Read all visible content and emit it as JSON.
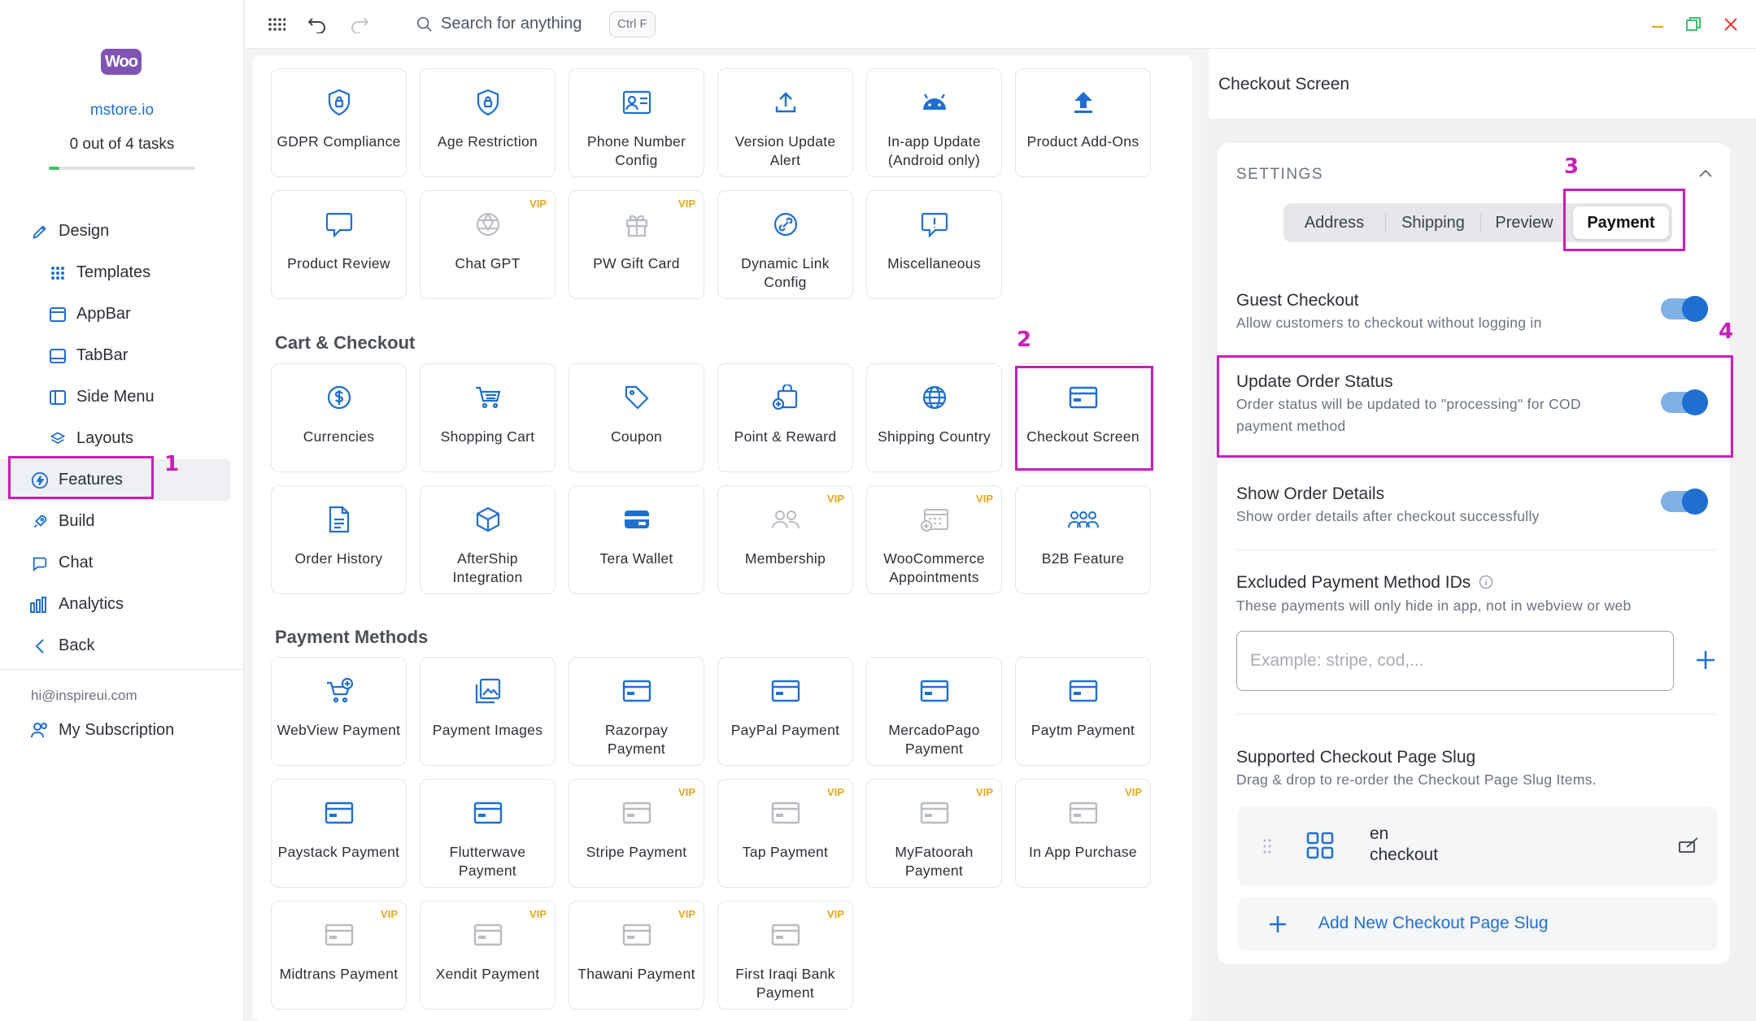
{
  "sidebar": {
    "logo_text": "Woo",
    "store_name": "mstore.io",
    "tasks_text": "0 out of 4 tasks",
    "progress": 0.07,
    "items": [
      {
        "label": "Design"
      },
      {
        "label": "Templates"
      },
      {
        "label": "AppBar"
      },
      {
        "label": "TabBar"
      },
      {
        "label": "Side Menu"
      },
      {
        "label": "Layouts"
      },
      {
        "label": "Features"
      },
      {
        "label": "Build"
      },
      {
        "label": "Chat"
      },
      {
        "label": "Analytics"
      },
      {
        "label": "Back"
      }
    ],
    "email": "hi@inspireui.com",
    "subscription": "My Subscription"
  },
  "topbar": {
    "search_placeholder": "Search for anything",
    "shortcut": "Ctrl F"
  },
  "features": {
    "row1": [
      "GDPR Compliance",
      "Age Restriction",
      "Phone Number Config",
      "Version Update Alert",
      "In-app Update (Android only)",
      "Product Add-Ons"
    ],
    "row2": [
      "Product Review",
      "Chat GPT",
      "PW Gift Card",
      "Dynamic Link Config",
      "Miscellaneous"
    ],
    "cart_title": "Cart & Checkout",
    "cart1": [
      "Currencies",
      "Shopping Cart",
      "Coupon",
      "Point & Reward",
      "Shipping Country",
      "Checkout Screen"
    ],
    "cart2": [
      "Order History",
      "AfterShip Integration",
      "Tera Wallet",
      "Membership",
      "WooCommerce Appointments",
      "B2B Feature"
    ],
    "payment_title": "Payment Methods",
    "pay1": [
      "WebView Payment",
      "Payment Images",
      "Razorpay Payment",
      "PayPal Payment",
      "MercadoPago Payment",
      "Paytm Payment"
    ],
    "pay2": [
      "Paystack Payment",
      "Flutterwave Payment",
      "Stripe Payment",
      "Tap Payment",
      "MyFatoorah Payment",
      "In App Purchase"
    ],
    "pay3": [
      "Midtrans Payment",
      "Xendit Payment",
      "Thawani Payment",
      "First Iraqi Bank Payment"
    ],
    "vip_label": "VIP"
  },
  "panel": {
    "title": "Checkout Screen",
    "settings_label": "SETTINGS",
    "tabs": [
      "Address",
      "Shipping",
      "Preview",
      "Payment"
    ],
    "guest_title": "Guest Checkout",
    "guest_desc": "Allow customers to checkout without logging in",
    "update_title": "Update Order Status",
    "update_desc1": "Order status will be updated to \"processing\" for COD",
    "update_desc2": "payment method",
    "details_title": "Show Order Details",
    "details_desc": "Show order details after checkout successfully",
    "excluded_title": "Excluded Payment Method IDs",
    "excluded_desc": "These payments will only hide in app, not in webview or web",
    "excluded_placeholder": "Example: stripe, cod,...",
    "slug_title": "Supported Checkout Page Slug",
    "slug_desc": "Drag & drop to re-order the Checkout Page Slug Items.",
    "slug_lang": "en",
    "slug_value": "checkout",
    "add_slug": "Add New Checkout Page Slug"
  },
  "annotations": [
    "1",
    "2",
    "3",
    "4"
  ],
  "colors": {
    "accent": "#1f6fd1",
    "annotation": "#c71fb8",
    "vip": "#e5a71a",
    "woo": "#7f54b3"
  }
}
